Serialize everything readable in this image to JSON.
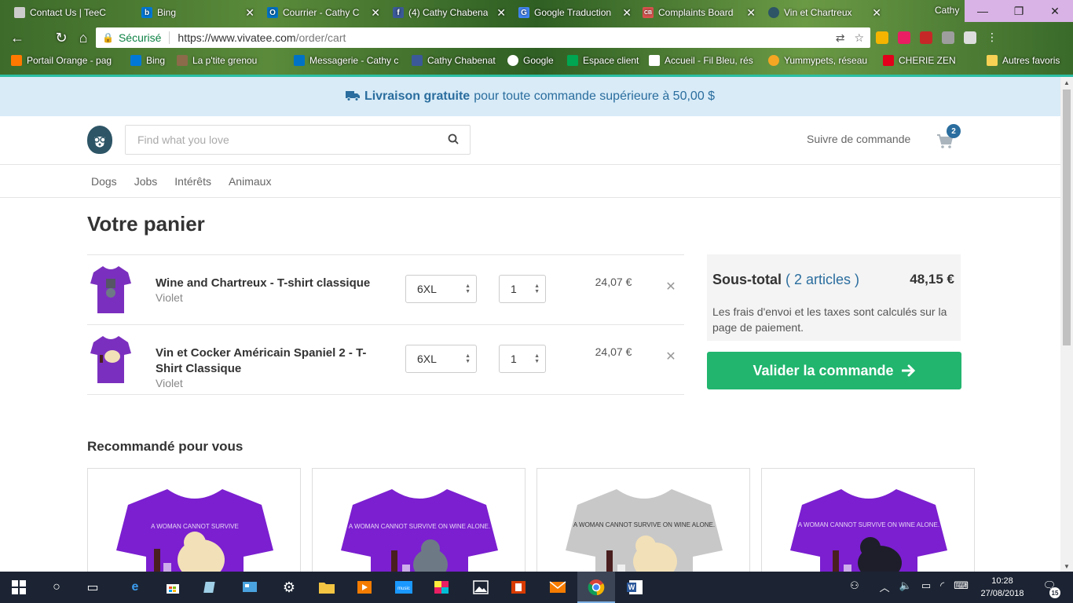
{
  "browser": {
    "tabs": [
      {
        "label": "Contact Us | TeeC",
        "icon_color": "#cccccc",
        "icon": "page-icon"
      },
      {
        "label": "Bing",
        "icon_color": "#0078d7",
        "icon": "bing-icon"
      },
      {
        "label": "Courrier - Cathy C",
        "icon_color": "#0072c6",
        "icon": "outlook-icon"
      },
      {
        "label": "(4) Cathy Chabena",
        "icon_color": "#3b5998",
        "icon": "facebook-icon"
      },
      {
        "label": "Google Traduction",
        "icon_color": "#4285f4",
        "icon": "translate-icon"
      },
      {
        "label": "Complaints Board",
        "icon_color": "#d9534f",
        "icon": "cb-icon"
      },
      {
        "label": "Vin et Chartreux",
        "icon_color": "#2d5566",
        "icon": "vivatee-icon"
      }
    ],
    "profile": "Cathy",
    "address": {
      "secure_label": "Sécurisé",
      "url_main": "https://www.vivatee.com",
      "url_path": "/order/cart"
    },
    "bookmarks": [
      {
        "label": "Portail Orange - pag",
        "color": "#ff7900"
      },
      {
        "label": "Bing",
        "color": "#0078d7"
      },
      {
        "label": "La p'tite grenou",
        "color": "#8b6b4a"
      },
      {
        "label": "Messagerie - Cathy c",
        "color": "#0072c6"
      },
      {
        "label": "Cathy Chabenat",
        "color": "#3b5998"
      },
      {
        "label": "Google",
        "color": "#ffffff"
      },
      {
        "label": "Espace client",
        "color": "#00a651"
      },
      {
        "label": "Accueil - Fil Bleu, rés",
        "color": "#ffffff"
      },
      {
        "label": "Yummypets, réseau",
        "color": "#f5a623"
      },
      {
        "label": "CHERIE ZEN",
        "color": "#e2001a"
      },
      {
        "label": "Autres favoris",
        "color": "#f7d154"
      }
    ]
  },
  "promo": {
    "bold": "Livraison gratuite",
    "text": "pour toute commande supérieure à 50,00 $"
  },
  "header": {
    "search_placeholder": "Find what you love",
    "track_label": "Suivre de commande",
    "cart_count": "2"
  },
  "categories": [
    "Dogs",
    "Jobs",
    "Intérêts",
    "Animaux"
  ],
  "cart": {
    "title": "Votre panier",
    "items": [
      {
        "name": "Wine and Chartreux - T-shirt classique",
        "color": "Violet",
        "size": "6XL",
        "qty": "1",
        "price": "24,07 €",
        "shirt_color": "#7b2fbf"
      },
      {
        "name": "Vin et Cocker Américain Spaniel 2 - T-Shirt Classique",
        "color": "Violet",
        "size": "6XL",
        "qty": "1",
        "price": "24,07 €",
        "shirt_color": "#7b2fbf"
      }
    ]
  },
  "summary": {
    "label": "Sous-total",
    "count": "( 2 articles )",
    "total": "48,15 €",
    "note": "Les frais d'envoi et les taxes sont calculés sur la page de paiement.",
    "checkout_label": "Valider la commande"
  },
  "recommended": {
    "title": "Recommandé pour vous",
    "products": [
      {
        "shirt_color": "#7b1fd0",
        "slogan": "A WOMAN CANNOT SURVIVE",
        "pet_color": "#f2e0b8"
      },
      {
        "shirt_color": "#7b1fd0",
        "slogan": "A WOMAN CANNOT SURVIVE ON WINE ALONE.",
        "pet_color": "#6d7a85"
      },
      {
        "shirt_color": "#c8c8c8",
        "slogan": "A WOMAN CANNOT SURVIVE ON WINE ALONE.",
        "pet_color": "#f2e0b8"
      },
      {
        "shirt_color": "#7b1fd0",
        "slogan": "A WOMAN CANNOT SURVIVE ON WINE ALONE.",
        "pet_color": "#1e1e2a"
      }
    ]
  },
  "taskbar": {
    "time": "10:28",
    "date": "27/08/2018",
    "notifications": "15"
  }
}
